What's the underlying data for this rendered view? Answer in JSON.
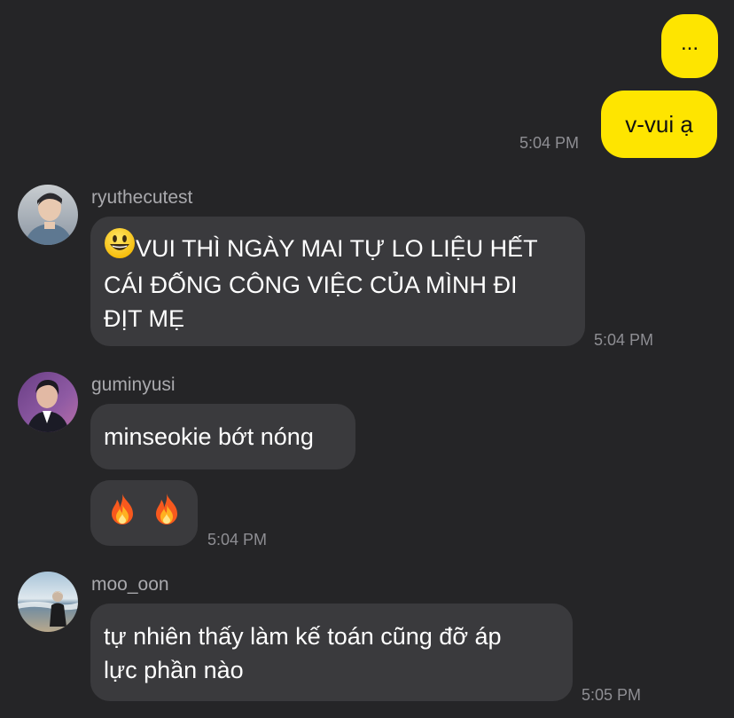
{
  "conversation": {
    "outgoing": [
      {
        "text": "...",
        "time": ""
      },
      {
        "text": "v-vui ạ",
        "time": "5:04 PM"
      }
    ],
    "groups": [
      {
        "username": "ryuthecutest",
        "avatar_icon": "avatar-ryuthecutest-icon",
        "messages": [
          {
            "emoji": "grinning-face-icon",
            "lines": [
              "VUI THÌ NGÀY MAI TỰ LO LIỆU HẾT",
              "CÁI ĐỐNG CÔNG VIỆC CỦA MÌNH ĐI",
              "ĐỊT MẸ"
            ],
            "time": "5:04 PM"
          }
        ]
      },
      {
        "username": "guminyusi",
        "avatar_icon": "avatar-guminyusi-icon",
        "messages": [
          {
            "text": "minseokie bớt nóng",
            "time": ""
          },
          {
            "emojis": [
              "fire-icon",
              "fire-icon"
            ],
            "time": "5:04 PM"
          }
        ]
      },
      {
        "username": "moo_oon",
        "avatar_icon": "avatar-moo-oon-icon",
        "messages": [
          {
            "lines": [
              "tự nhiên thấy làm kế toán cũng đỡ áp",
              "lực phần nào"
            ],
            "time": "5:05 PM"
          }
        ]
      }
    ]
  },
  "colors": {
    "background": "#252527",
    "outgoing_bubble": "#FEE500",
    "incoming_bubble": "#3a3a3d",
    "timestamp": "#8e8e93",
    "username": "#a9a9ad"
  }
}
